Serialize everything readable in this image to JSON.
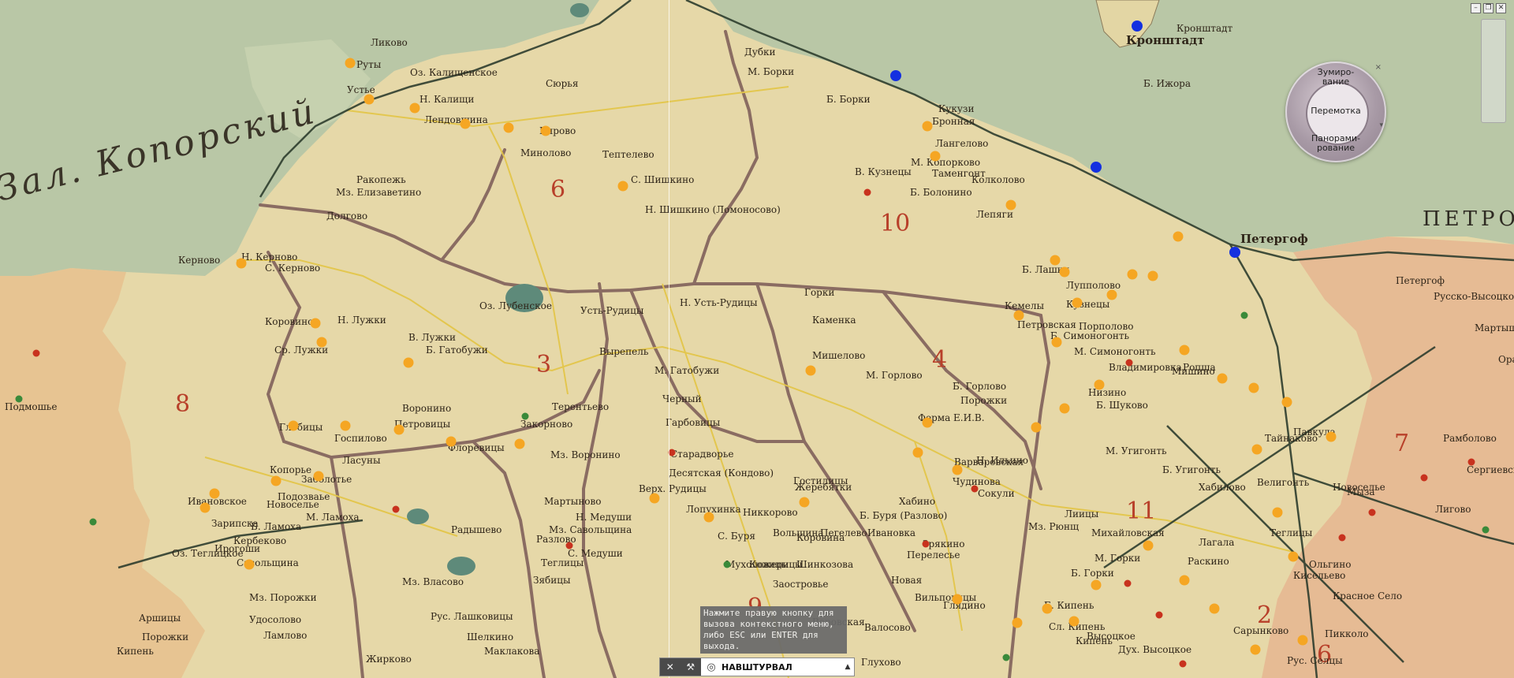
{
  "map": {
    "region_label": "Зал. Копорский",
    "labels": [
      {
        "text": "Ликово"
      },
      {
        "text": "Руты"
      },
      {
        "text": "Устье"
      },
      {
        "text": "Оз. Калищенское"
      },
      {
        "text": "Н. Калищи"
      },
      {
        "text": "Лендовщина"
      },
      {
        "text": "Кпрово"
      },
      {
        "text": "Сюрья"
      },
      {
        "text": "Минолово"
      },
      {
        "text": "Тептелево"
      },
      {
        "text": "С. Шишкино"
      },
      {
        "text": "Ракопежь"
      },
      {
        "text": "Мз. Елизаветино"
      },
      {
        "text": "Долгово"
      },
      {
        "text": "Н. Шишкино (Ломоносово)"
      },
      {
        "text": "Керново"
      },
      {
        "text": "Н. Керново"
      },
      {
        "text": "С. Керново"
      },
      {
        "text": "Оз. Лубенское"
      },
      {
        "text": "Усть-Рудицы"
      },
      {
        "text": "Н. Усть-Рудицы"
      },
      {
        "text": "Горки"
      },
      {
        "text": "Каменка"
      },
      {
        "text": "Мишелово"
      },
      {
        "text": "М. Горлово"
      },
      {
        "text": "Б. Горлово"
      },
      {
        "text": "Петровская"
      },
      {
        "text": "Ферма Е.И.В."
      },
      {
        "text": "Порожки"
      },
      {
        "text": "Коровино"
      },
      {
        "text": "Н. Лужки"
      },
      {
        "text": "Ср. Лужки"
      },
      {
        "text": "В. Лужки"
      },
      {
        "text": "Б. Гатобужи"
      },
      {
        "text": "М. Гатобужи"
      },
      {
        "text": "Вырепель"
      },
      {
        "text": "Черный"
      },
      {
        "text": "Терентьево"
      },
      {
        "text": "Закорново"
      },
      {
        "text": "Мз. Воронино"
      },
      {
        "text": "Воронино"
      },
      {
        "text": "Петровицы"
      },
      {
        "text": "Флоревицы"
      },
      {
        "text": "Глобицы"
      },
      {
        "text": "Госпилово"
      },
      {
        "text": "Гарбовицы"
      },
      {
        "text": "Старадворье"
      },
      {
        "text": "Десятская (Кондово)"
      },
      {
        "text": "Верх. Рудицы"
      },
      {
        "text": "Лопухинка"
      },
      {
        "text": "Никкорово"
      },
      {
        "text": "Б. Буря (Разлово)"
      },
      {
        "text": "Жеребятки"
      },
      {
        "text": "Гостилицы"
      },
      {
        "text": "Копорье"
      },
      {
        "text": "Заболотье"
      },
      {
        "text": "Подозваье"
      },
      {
        "text": "Новоселье"
      },
      {
        "text": "Ласуны"
      },
      {
        "text": "Мартыново"
      },
      {
        "text": "Радышево"
      },
      {
        "text": "Мз. Савольщина"
      },
      {
        "text": "С. Медуши"
      },
      {
        "text": "Н. Медуши"
      },
      {
        "text": "Разлово"
      },
      {
        "text": "С. Буря"
      },
      {
        "text": "Мухоловицы"
      },
      {
        "text": "Кожерицы"
      },
      {
        "text": "Заостровье"
      },
      {
        "text": "Коровина"
      },
      {
        "text": "Шинкозова"
      },
      {
        "text": "Подмошье"
      },
      {
        "text": "Ивановское"
      },
      {
        "text": "Зарипска"
      },
      {
        "text": "Ирогоши"
      },
      {
        "text": "Кербеково"
      },
      {
        "text": "Б. Ламоха"
      },
      {
        "text": "М. Ламоха"
      },
      {
        "text": "Оз. Теглицкое"
      },
      {
        "text": "Савольщина"
      },
      {
        "text": "Мз. Власово"
      },
      {
        "text": "Теглицы"
      },
      {
        "text": "Зябицы"
      },
      {
        "text": "Рус. Лашковицы"
      },
      {
        "text": "Маклакова"
      },
      {
        "text": "Шелкино"
      },
      {
        "text": "Жирково"
      },
      {
        "text": "Мз. Порожки"
      },
      {
        "text": "Удосолово"
      },
      {
        "text": "Ламлово"
      },
      {
        "text": "Порожки"
      },
      {
        "text": "Кипень"
      },
      {
        "text": "Аршицы"
      },
      {
        "text": "Воровская"
      },
      {
        "text": "Валосово"
      },
      {
        "text": "Глухово"
      },
      {
        "text": "Глядино"
      },
      {
        "text": "Сокули"
      },
      {
        "text": "Н. Ильино"
      },
      {
        "text": "Вильповицы"
      },
      {
        "text": "Новая"
      },
      {
        "text": "Зрякино"
      },
      {
        "text": "Перелесье"
      },
      {
        "text": "Варваровская"
      },
      {
        "text": "Чудинова"
      },
      {
        "text": "Хабино"
      },
      {
        "text": "Лиицы"
      },
      {
        "text": "Мз. Рюнщ"
      },
      {
        "text": "Михайловская"
      },
      {
        "text": "М. Горки"
      },
      {
        "text": "Б. Горки"
      },
      {
        "text": "Б. Кипень"
      },
      {
        "text": "Сл. Кипень"
      },
      {
        "text": "Высоцкое"
      },
      {
        "text": "Дух. Высоцкое"
      },
      {
        "text": "Кипень"
      },
      {
        "text": "Красное Село"
      },
      {
        "text": "Ропша"
      },
      {
        "text": "Петергоф"
      },
      {
        "text": "Кронштадт"
      },
      {
        "text": "Ораниенбаум"
      },
      {
        "text": "Мартышкино"
      },
      {
        "text": "Лигово"
      },
      {
        "text": "Сергиевская"
      },
      {
        "text": "Русско-Высоцкое"
      },
      {
        "text": "Б. Ижора"
      },
      {
        "text": "М. Борки"
      },
      {
        "text": "Б. Борки"
      },
      {
        "text": "Дубки"
      },
      {
        "text": "Кукузи"
      },
      {
        "text": "Бронная"
      },
      {
        "text": "Лангелово"
      },
      {
        "text": "М. Копорково"
      },
      {
        "text": "Таменгонт"
      },
      {
        "text": "В. Кузнецы"
      },
      {
        "text": "Б. Болонино"
      },
      {
        "text": "Колколово"
      },
      {
        "text": "Лепяги"
      },
      {
        "text": "Б. Лашки"
      },
      {
        "text": "Кемелы"
      },
      {
        "text": "Лупполово"
      },
      {
        "text": "Кузнецы"
      },
      {
        "text": "Порполово"
      },
      {
        "text": "Б. Симоногонть"
      },
      {
        "text": "М. Симоногонть"
      },
      {
        "text": "Низино"
      },
      {
        "text": "Мишино"
      },
      {
        "text": "Владимировка"
      },
      {
        "text": "Б. Шуково"
      },
      {
        "text": "М. Угигонть"
      },
      {
        "text": "Б. Угигонть"
      },
      {
        "text": "Хабилово"
      },
      {
        "text": "Велигонть"
      },
      {
        "text": "Тайнаково"
      },
      {
        "text": "Павкула"
      },
      {
        "text": "Мыза"
      },
      {
        "text": "Новоселье"
      },
      {
        "text": "Кисельево"
      },
      {
        "text": "Пикколо"
      },
      {
        "text": "Рус. Селцы"
      },
      {
        "text": "Сарынково"
      },
      {
        "text": "Лагала"
      },
      {
        "text": "Раскино"
      },
      {
        "text": "Теглицы"
      },
      {
        "text": "Ольгино"
      },
      {
        "text": "Рамболово"
      },
      {
        "text": "Вольщина"
      },
      {
        "text": "Пегелево"
      },
      {
        "text": "Ивановка"
      }
    ],
    "district_numbers": [
      "6",
      "10",
      "3",
      "4",
      "8",
      "11",
      "7",
      "2",
      "6",
      "9"
    ],
    "cities": [
      "Кронштадт",
      "Петергоф",
      "ПЕТРОГ",
      "Ораниенбаум"
    ]
  },
  "navwheel": {
    "zoom_label": "Зумиро-\nвание",
    "rewind_label": "Перемотка",
    "pan_label": "Панорами-\nрование",
    "close_label": "×",
    "arrow_label": "▾"
  },
  "tooltip": {
    "text": "Нажмите правую кнопку для вызова контекстного меню, либо ESC или ENTER для выхода."
  },
  "statusbar": {
    "label": "НАВШТУРВАЛ",
    "close_tool": "✕",
    "wrench_tool": "⚒",
    "arrow": "▲"
  },
  "window": {
    "minimize": "–",
    "restore": "❐",
    "close": "✕"
  },
  "colors": {
    "paper": "#e6d8a8",
    "sea": "#b9c7a6",
    "road_primary": "#7a5a56",
    "road_secondary": "#e3c64a",
    "railway": "#2e3d2e",
    "orange_marker": "#f5a623",
    "blue_marker": "#1430e0",
    "red_dot": "#c8321e",
    "green_dot": "#3a8a3a"
  }
}
